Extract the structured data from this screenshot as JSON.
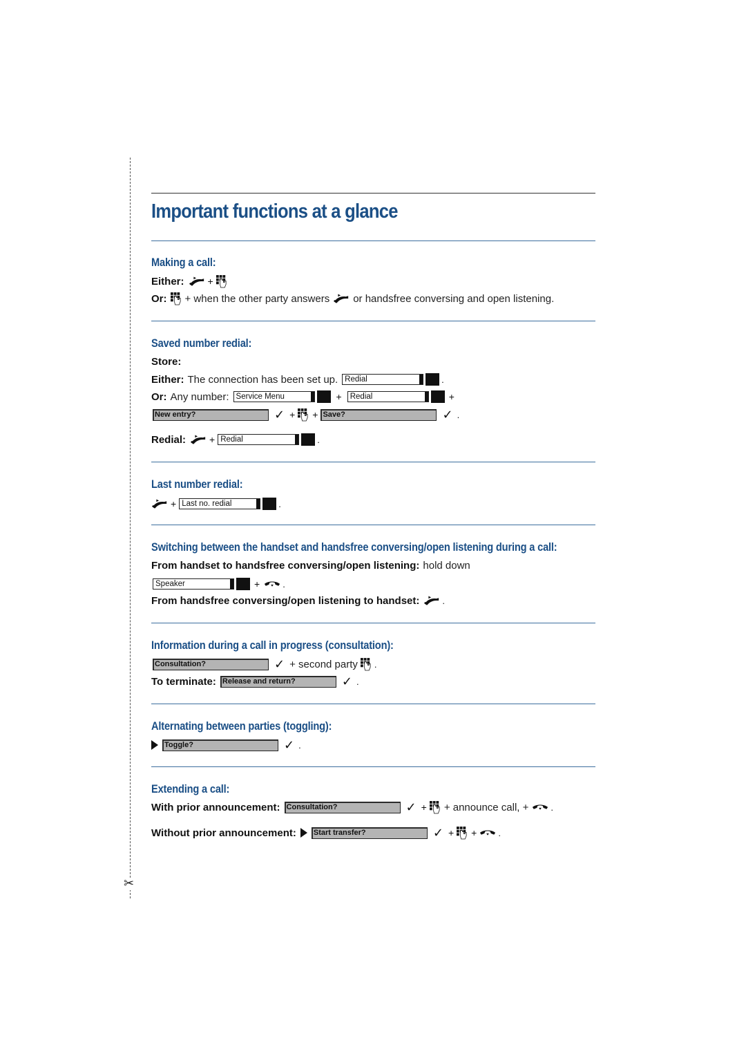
{
  "title": "Important functions at a glance",
  "sections": {
    "making_call": {
      "heading": "Making a call:",
      "either_label": "Either:",
      "or_label": "Or:",
      "or_text_1": "+ when the other party answers",
      "or_text_2": "or handsfree conversing and open listening."
    },
    "saved_redial": {
      "heading": "Saved number redial:",
      "store_label": "Store:",
      "either_label": "Either:",
      "either_text": "The connection has been set up.",
      "either_display": "Redial",
      "or_label": "Or:",
      "or_text": "Any number:",
      "or_display_1": "Service Menu",
      "or_display_2": "Redial",
      "menu_new_entry": "New entry?",
      "menu_save": "Save?",
      "redial_label": "Redial:",
      "redial_display": "Redial"
    },
    "last_redial": {
      "heading": "Last number redial:",
      "display": "Last no. redial"
    },
    "switching": {
      "heading": "Switching between the handset and handsfree conversing/open listening during a call:",
      "to_handsfree_label": "From handset to handsfree conversing/open listening:",
      "to_handsfree_text": "hold down",
      "speaker_display": "Speaker",
      "to_handset_label": "From handsfree conversing/open listening to handset:"
    },
    "consultation": {
      "heading": "Information during a call in progress (consultation):",
      "menu_consultation": "Consultation?",
      "second_party_text": "+ second party",
      "terminate_label": "To terminate:",
      "menu_release": "Release and return?"
    },
    "toggling": {
      "heading": "Alternating between parties (toggling):",
      "menu_toggle": "Toggle?"
    },
    "extending": {
      "heading": "Extending a call:",
      "with_label": "With prior announcement:",
      "menu_consultation": "Consultation?",
      "announce_text": "+ announce call, +",
      "without_label": "Without prior announcement:",
      "menu_start_transfer": "Start transfer?"
    }
  },
  "symbols": {
    "plus": "+",
    "period": ".",
    "check": "✓",
    "scissors": "✂"
  },
  "colors": {
    "heading": "#1b4f86",
    "rule": "#3c6e9e",
    "menu_fill": "#b4b4b4"
  }
}
